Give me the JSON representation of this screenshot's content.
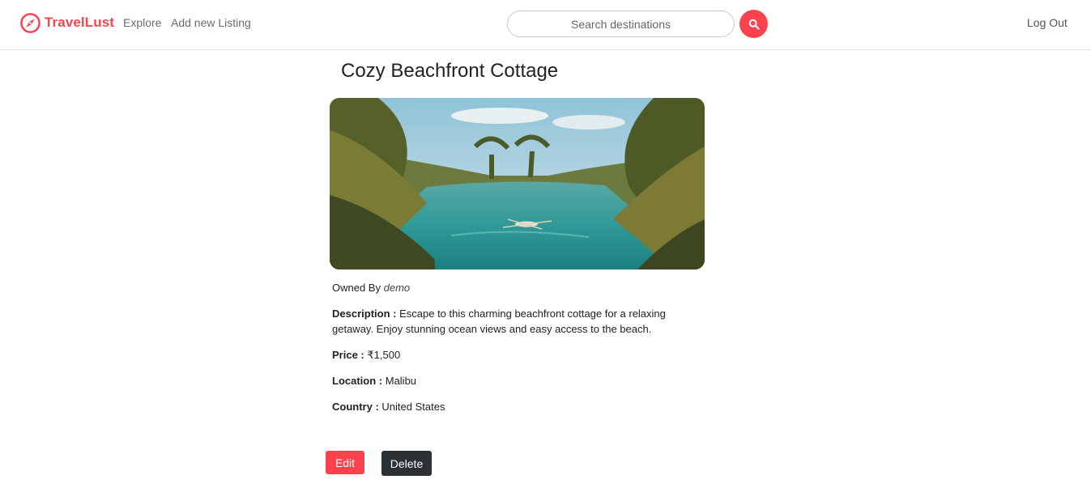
{
  "nav": {
    "brand": "TravelLust",
    "brand_icon": "compass-icon",
    "links": {
      "explore": "Explore",
      "add_listing": "Add new Listing"
    },
    "search": {
      "placeholder": "Search destinations",
      "button_icon": "search-icon"
    },
    "logout": "Log Out"
  },
  "listing": {
    "title": "Cozy Beachfront Cottage",
    "image_alt": "Tropical lagoon with palm trees and a small boat",
    "owned_by_label": "Owned By",
    "owner": "demo",
    "description_label": "Description :",
    "description": "Escape to this charming beachfront cottage for a relaxing getaway. Enjoy stunning ocean views and easy access to the beach.",
    "price_label": "Price :",
    "price": "₹1,500",
    "location_label": "Location :",
    "location": "Malibu",
    "country_label": "Country :",
    "country": "United States"
  },
  "actions": {
    "edit": "Edit",
    "delete": "Delete"
  },
  "colors": {
    "accent": "#fe424d",
    "dark_button": "#2b3035"
  }
}
